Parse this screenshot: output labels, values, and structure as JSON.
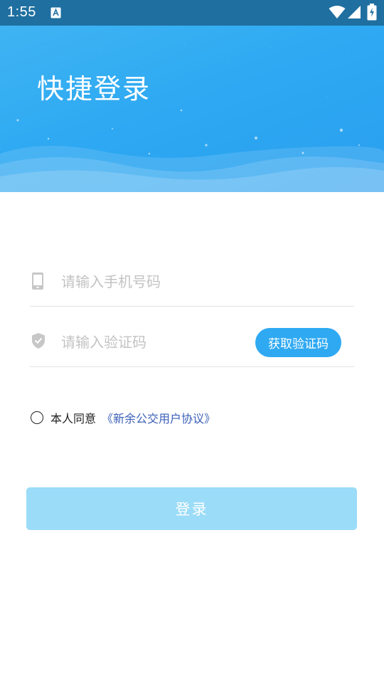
{
  "status_bar": {
    "time": "1:55",
    "notification_icon": "a-icon",
    "wifi_icon": "wifi-icon",
    "signal_icon": "signal-icon",
    "battery_icon": "battery-charging-icon"
  },
  "header": {
    "title": "快捷登录"
  },
  "form": {
    "phone": {
      "icon": "phone-icon",
      "placeholder": "请输入手机号码",
      "value": ""
    },
    "code": {
      "icon": "shield-check-icon",
      "placeholder": "请输入验证码",
      "value": "",
      "button_label": "获取验证码"
    }
  },
  "agreement": {
    "text": "本人同意",
    "link": "《新余公交用户协议》",
    "checked": false
  },
  "login_button": {
    "label": "登录"
  },
  "colors": {
    "primary": "#2ea9f2",
    "status_bar": "#1f6fa0",
    "login_disabled": "#9bdcf8",
    "link": "#3a5fb8",
    "placeholder": "#c3c3c3"
  }
}
